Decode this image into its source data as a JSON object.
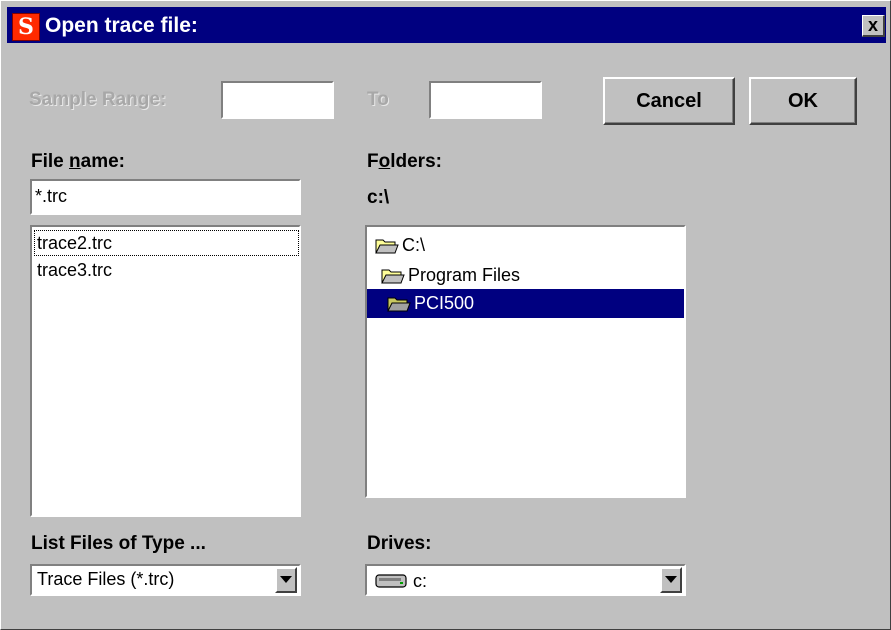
{
  "window": {
    "title": "Open trace file:",
    "close_glyph": "x",
    "app_icon_glyph": "S",
    "app_icon": "app-logo-icon"
  },
  "sample_range": {
    "label": "Sample Range:",
    "from_value": "",
    "to_label": "To",
    "to_value": ""
  },
  "buttons": {
    "cancel": "Cancel",
    "ok": "OK"
  },
  "file_name": {
    "label": "File name:",
    "label_pre": "File ",
    "label_mnemonic": "n",
    "label_post": "ame:",
    "value": "*.trc",
    "files": [
      "trace2.trc",
      "trace3.trc"
    ]
  },
  "folders": {
    "label_pre": "F",
    "label_mnemonic": "o",
    "label_post": "lders:",
    "current_path": "c:\\",
    "tree": [
      {
        "name": "C:\\",
        "icon": "open-folder-icon",
        "selected": false
      },
      {
        "name": "Program Files",
        "icon": "open-folder-icon",
        "selected": false
      },
      {
        "name": "PCI500",
        "icon": "open-folder-icon",
        "selected": true
      }
    ]
  },
  "file_type": {
    "label": "List Files of Type ...",
    "value": "Trace Files (*.trc)"
  },
  "drives": {
    "label": "Drives:",
    "value": "c:",
    "icon": "drive-icon"
  },
  "colors": {
    "titlebar": "#000080",
    "face": "#c0c0c0",
    "selection": "#000080"
  }
}
